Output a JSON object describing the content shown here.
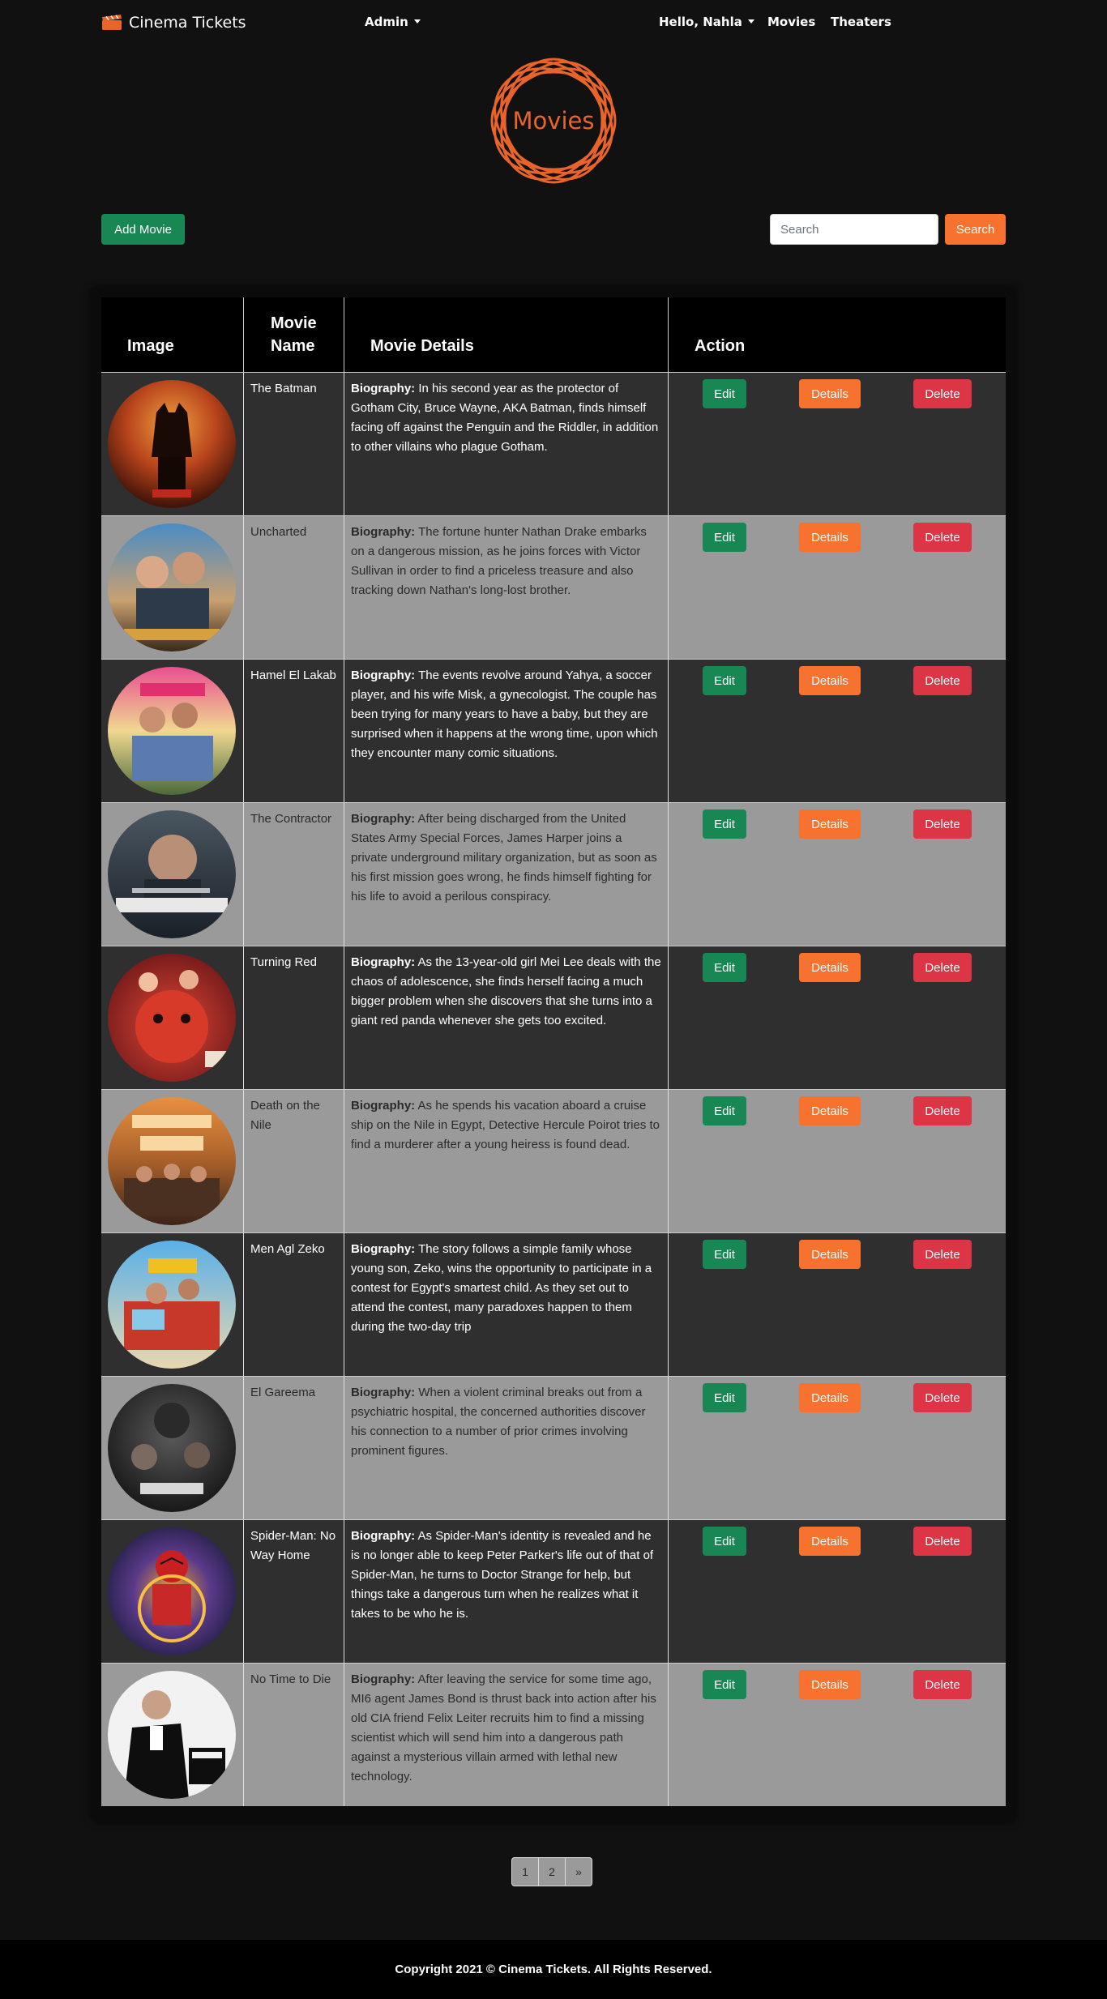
{
  "navbar": {
    "brand": "Cinema Tickets",
    "brand_icon": "clapperboard-icon",
    "admin_label": "Admin",
    "greeting": "Hello, Nahla",
    "movies_link": "Movies",
    "theaters_link": "Theaters"
  },
  "logo": {
    "text": "Movies",
    "color": "#e8642a"
  },
  "toolbar": {
    "add_label": "Add Movie",
    "search_placeholder": "Search",
    "search_label": "Search"
  },
  "table": {
    "headers": [
      "Image",
      "Movie Name",
      "Movie Details",
      "Action"
    ],
    "header_name_line1": "Movie",
    "header_name_line2": "Name",
    "bio_label": "Biography:",
    "edit_label": "Edit",
    "details_label": "Details",
    "delete_label": "Delete",
    "rows": [
      {
        "name": "The Batman",
        "bio": "In his second year as the protector of Gotham City, Bruce Wayne, AKA Batman, finds himself facing off against the Penguin and the Riddler, in addition to other villains who plague Gotham."
      },
      {
        "name": "Uncharted",
        "bio": "The fortune hunter Nathan Drake embarks on a dangerous mission, as he joins forces with Victor Sullivan in order to find a priceless treasure and also tracking down Nathan's long-lost brother."
      },
      {
        "name": "Hamel El Lakab",
        "bio": "The events revolve around Yahya, a soccer player, and his wife Misk, a gynecologist. The couple has been trying for many years to have a baby, but they are surprised when it happens at the wrong time, upon which they encounter many comic situations."
      },
      {
        "name": "The Contractor",
        "bio": "After being discharged from the United States Army Special Forces, James Harper joins a private underground military organization, but as soon as his first mission goes wrong, he finds himself fighting for his life to avoid a perilous conspiracy."
      },
      {
        "name": "Turning Red",
        "bio": "As the 13-year-old girl Mei Lee deals with the chaos of adolescence, she finds herself facing a much bigger problem when she discovers that she turns into a giant red panda whenever she gets too excited."
      },
      {
        "name": "Death on the Nile",
        "bio": "As he spends his vacation aboard a cruise ship on the Nile in Egypt, Detective Hercule Poirot tries to find a murderer after a young heiress is found dead."
      },
      {
        "name": "Men Agl Zeko",
        "bio": "The story follows a simple family whose young son, Zeko, wins the opportunity to participate in a contest for Egypt's smartest child. As they set out to attend the contest, many paradoxes happen to them during the two-day trip"
      },
      {
        "name": "El Gareema",
        "bio": "When a violent criminal breaks out from a psychiatric hospital, the concerned authorities discover his connection to a number of prior crimes involving prominent figures."
      },
      {
        "name": "Spider-Man: No Way Home",
        "bio": "As Spider-Man's identity is revealed and he is no longer able to keep Peter Parker's life out of that of Spider-Man, he turns to Doctor Strange for help, but things take a dangerous turn when he realizes what it takes to be who he is."
      },
      {
        "name": "No Time to Die",
        "bio": "After leaving the service for some time ago, MI6 agent James Bond is thrust back into action after his old CIA friend Felix Leiter recruits him to find a missing scientist which will send him into a dangerous path against a mysterious villain armed with lethal new technology."
      }
    ]
  },
  "pagination": {
    "pages": [
      "1",
      "2",
      "»"
    ]
  },
  "footer": {
    "text": "Copyright 2021 © Cinema Tickets. All Rights Reserved."
  },
  "colors": {
    "background": "#111111",
    "row_dark": "#2f2f2f",
    "row_light": "#9a9a9a",
    "edit": "#198754",
    "details": "#f7722f",
    "delete": "#dc3545",
    "accent": "#e8642a"
  }
}
